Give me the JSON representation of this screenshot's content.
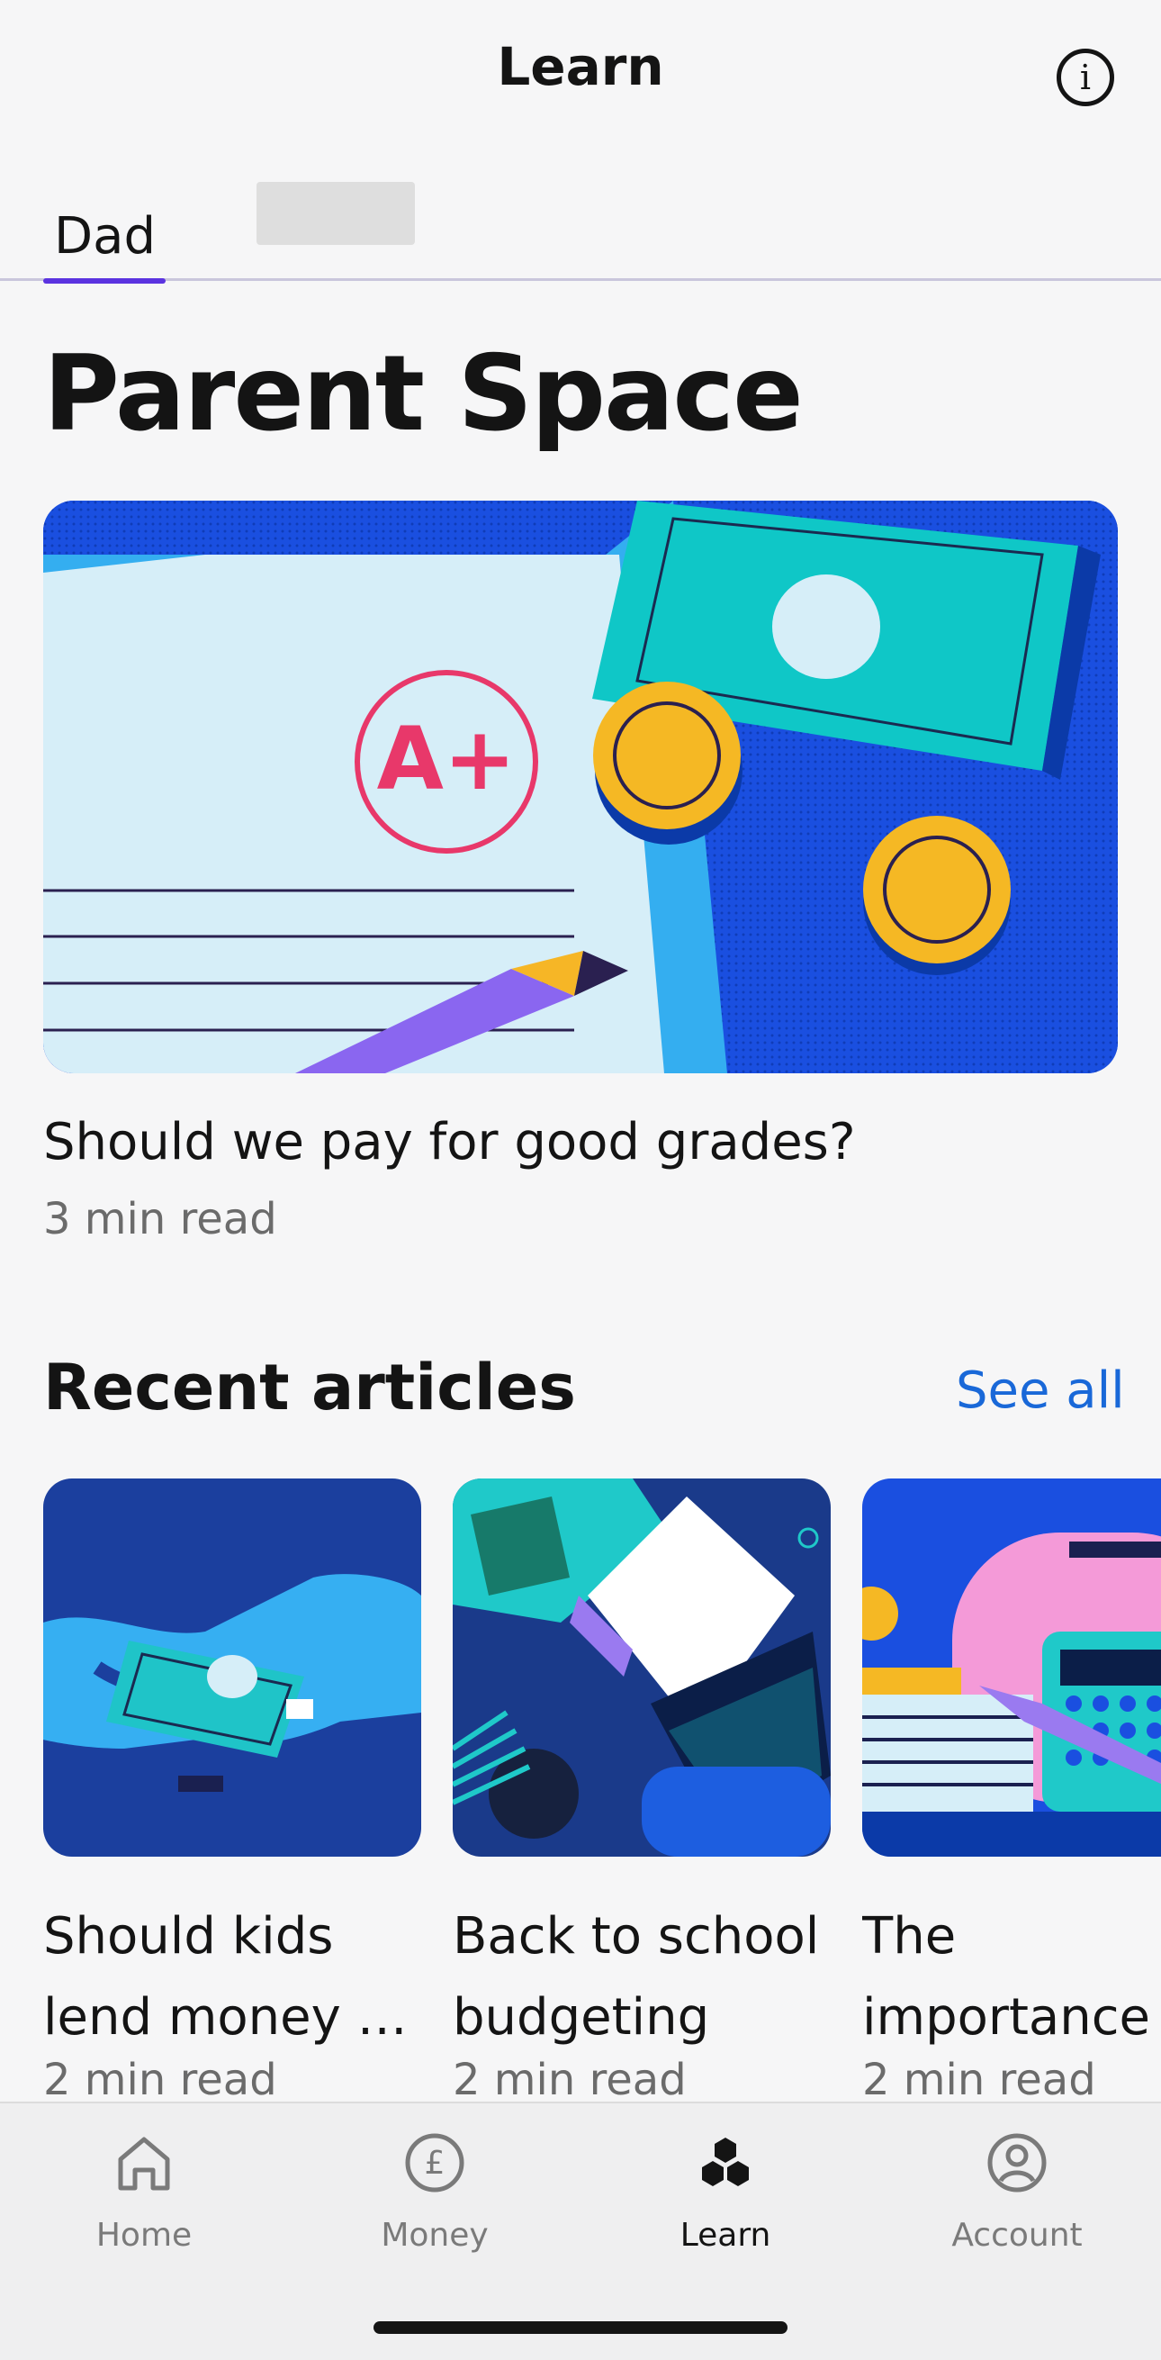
{
  "header": {
    "title": "Learn",
    "info_icon": "info-icon"
  },
  "tabs": [
    {
      "label": "Dad",
      "active": true
    },
    {
      "label": "",
      "redacted": true
    }
  ],
  "page": {
    "title": "Parent Space"
  },
  "featured": {
    "title": "Should we pay for good grades?",
    "meta": "3 min read",
    "grade": "A+"
  },
  "recent": {
    "title": "Recent articles",
    "see_all": "See all",
    "articles": [
      {
        "title_line1": "Should kids",
        "title_line2": "lend money t...",
        "meta": "2 min read"
      },
      {
        "title_line1": "Back to school",
        "title_line2": "budgeting",
        "meta": "2 min read"
      },
      {
        "title_line1": "The",
        "title_line2": "importance",
        "meta": "2 min read"
      }
    ]
  },
  "tabbar": [
    {
      "label": "Home",
      "icon": "home-icon",
      "active": false
    },
    {
      "label": "Money",
      "icon": "pound-icon",
      "active": false
    },
    {
      "label": "Learn",
      "icon": "learn-icon",
      "active": true
    },
    {
      "label": "Account",
      "icon": "account-icon",
      "active": false
    }
  ],
  "colors": {
    "accent": "#5b33e0",
    "link": "#1968d8",
    "hero_bg": "#1447d6"
  }
}
